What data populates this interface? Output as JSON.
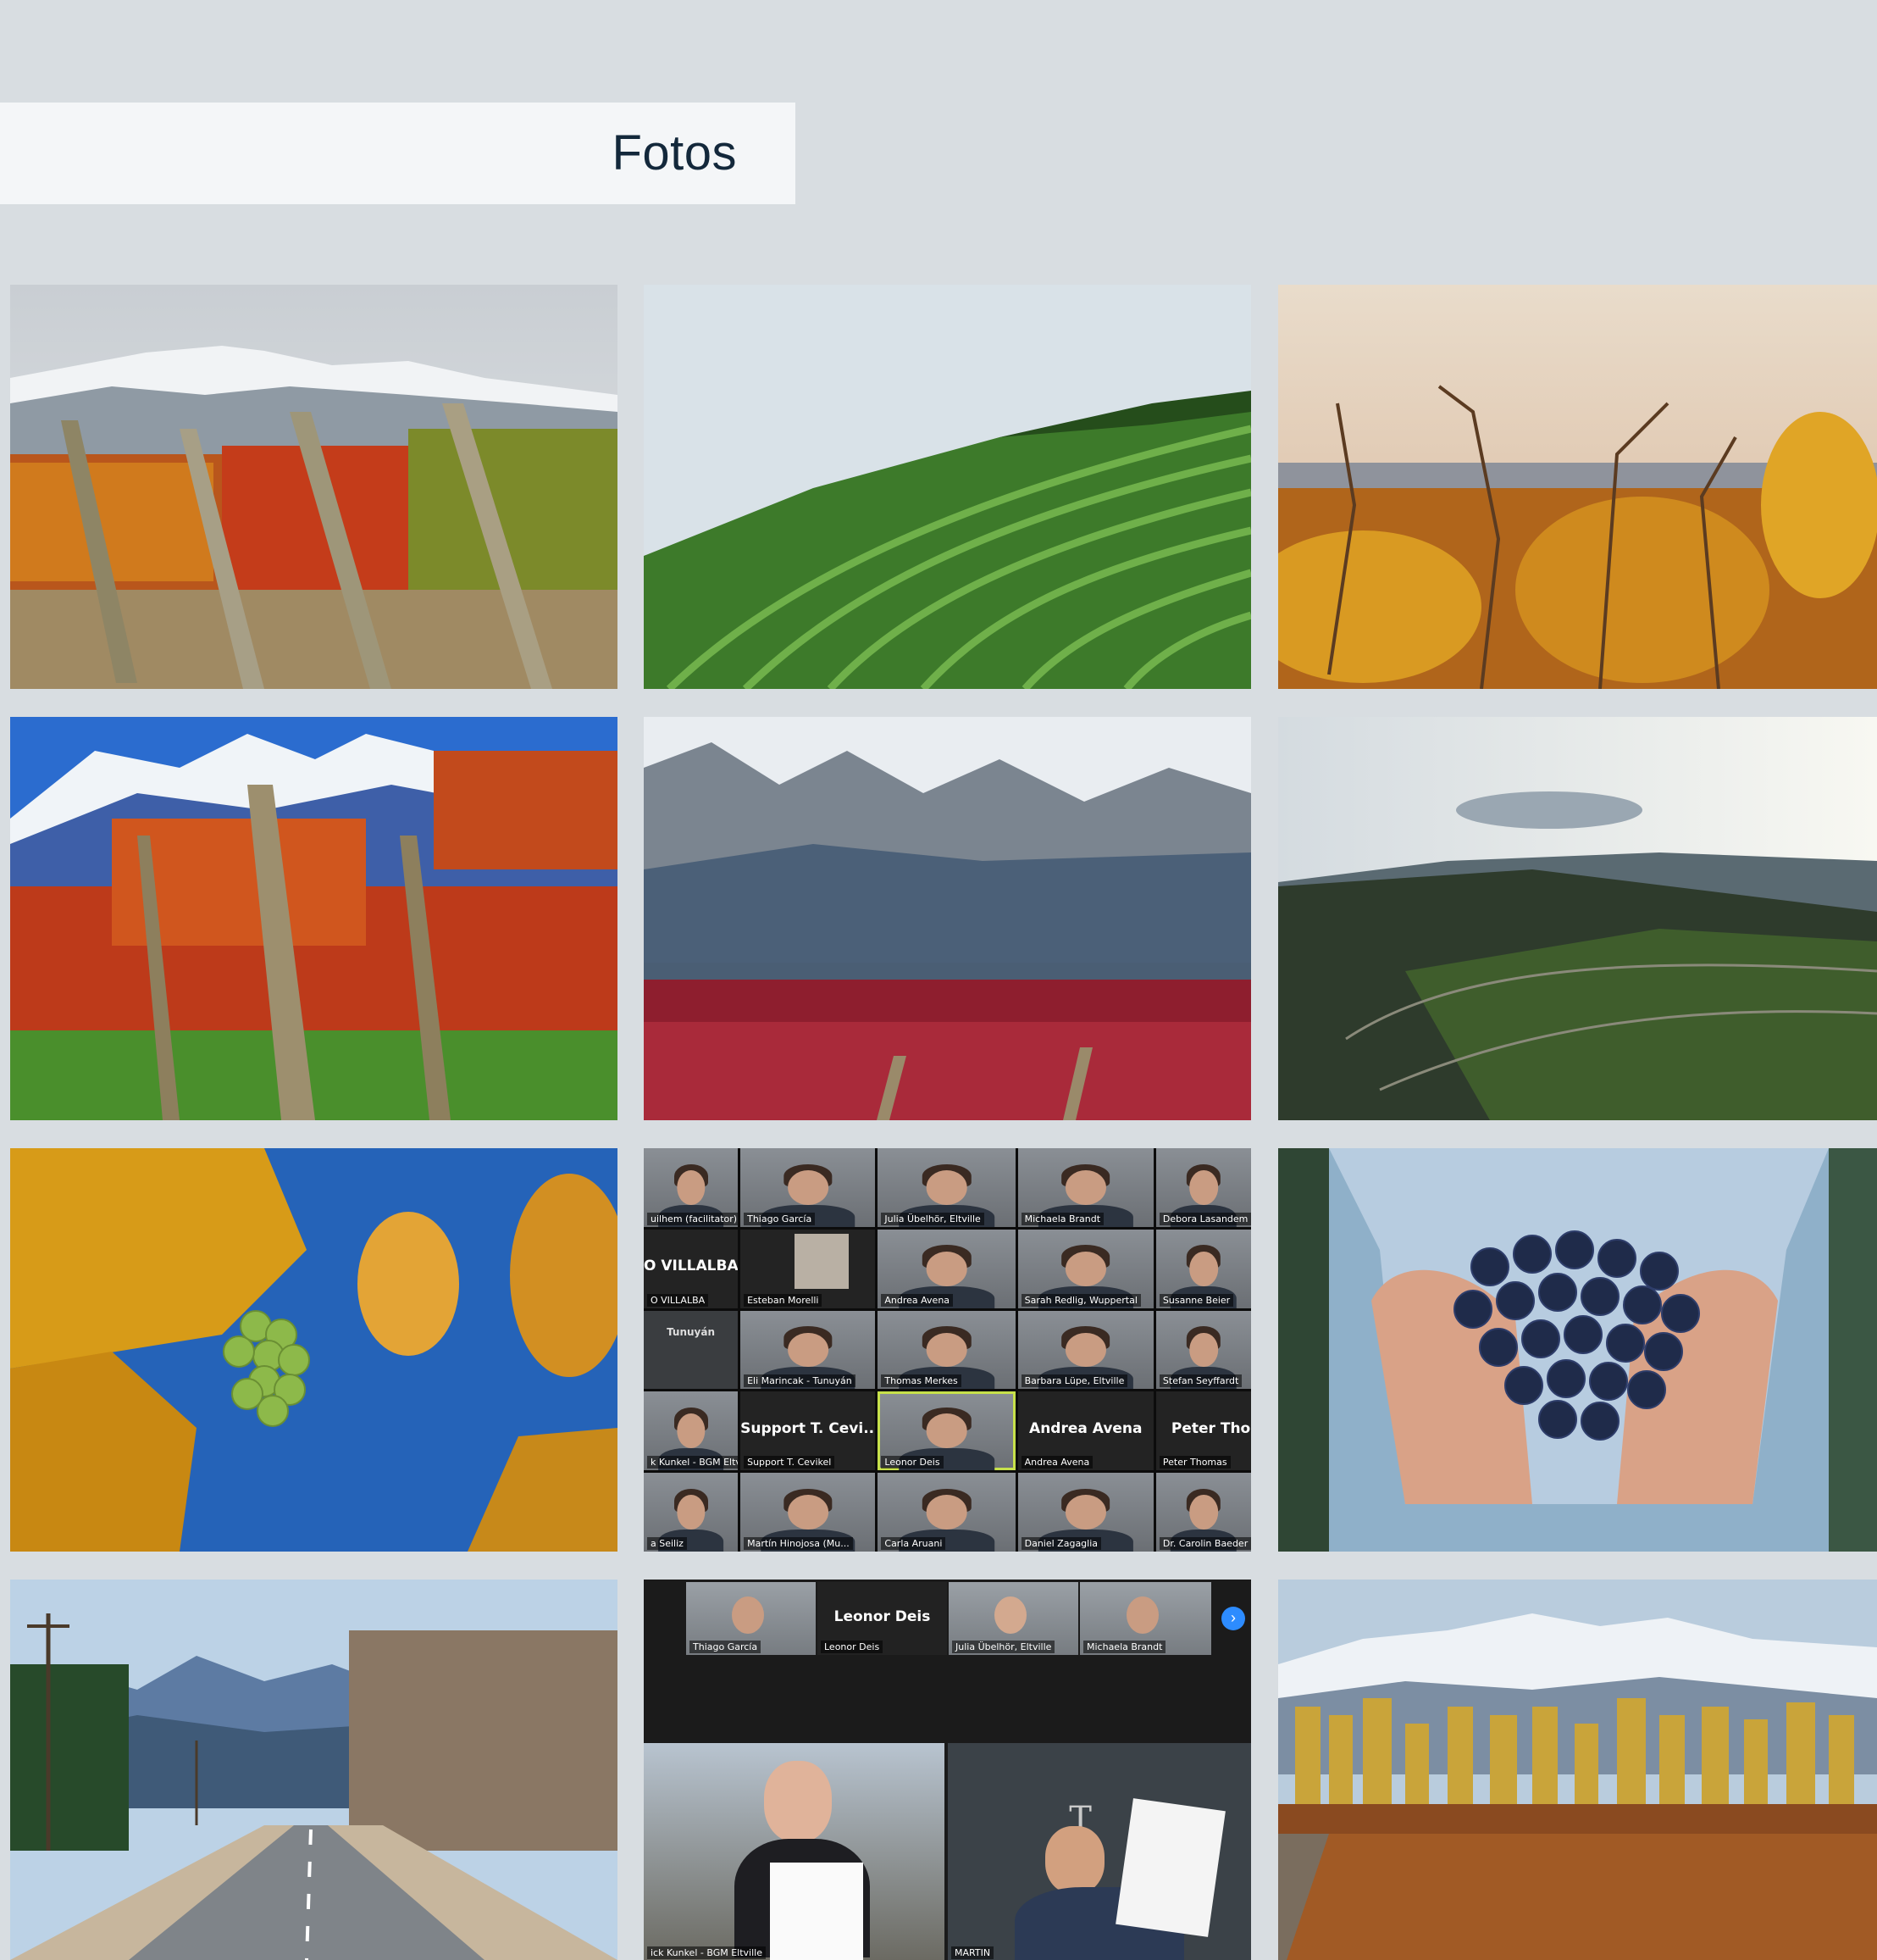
{
  "page": {
    "title": "Fotos"
  },
  "gallery": {
    "photos": [
      {
        "id": "vineyard-autumn-andes",
        "icon": "photo"
      },
      {
        "id": "green-vineyard-rows",
        "icon": "photo"
      },
      {
        "id": "vine-sunset",
        "icon": "photo"
      },
      {
        "id": "red-vineyard-blue-mountains",
        "icon": "photo"
      },
      {
        "id": "snowy-mountains-red-vineyard",
        "icon": "photo"
      },
      {
        "id": "aerial-vineyard-hills",
        "icon": "photo"
      },
      {
        "id": "green-grapes-autumn-leaves",
        "icon": "photo"
      },
      {
        "id": "video-conference-grid",
        "icon": "photo"
      },
      {
        "id": "hands-holding-grapes",
        "icon": "photo"
      },
      {
        "id": "road-mountains",
        "icon": "photo"
      },
      {
        "id": "video-conference-signing",
        "icon": "photo"
      },
      {
        "id": "snowy-mountains-poplars-vineyard",
        "icon": "photo"
      }
    ]
  },
  "conference_grid": {
    "participants": [
      "uilhem (facilitator)",
      "Thiago García",
      "Julia Übelhör, Eltville",
      "Michaela Brandt",
      "Debora Lasandem",
      "O VILLALBA",
      "Esteban Morelli",
      "Andrea Avena",
      "Sarah Redlig, Wuppertal",
      "Susanne Beier",
      "",
      "Eli Marincak - Tunuyán",
      "Thomas Merkes",
      "Barbara Lüpe, Eltville",
      "Stefan Seyffardt",
      "k Kunkel - BGM Eltv...",
      "Support T. Cevikel",
      "Leonor Deis",
      "Andrea Avena",
      "Peter Thomas",
      "a Seiliz",
      "Martín Hinojosa (Mu...",
      "Carla Aruani",
      "Daniel Zagaglia",
      "Dr. Carolin Baeder"
    ],
    "big_names": {
      "row2_col1": "O VILLALBA",
      "row4_col2": "Support T. Cevi...",
      "row4_col4": "Andrea Avena",
      "row4_col5": "Peter Thom"
    },
    "logo_text": "Tunuyán"
  },
  "conference_signing": {
    "strip": [
      "Thiago García",
      "Leonor Deis",
      "Julia Übelhör, Eltville",
      "Michaela Brandt"
    ],
    "strip_big_name": "Leonor Deis",
    "main": [
      "ick Kunkel - BGM Eltville",
      "MARTIN"
    ],
    "next_icon": "chevron-right-icon",
    "logo_text": "T"
  }
}
